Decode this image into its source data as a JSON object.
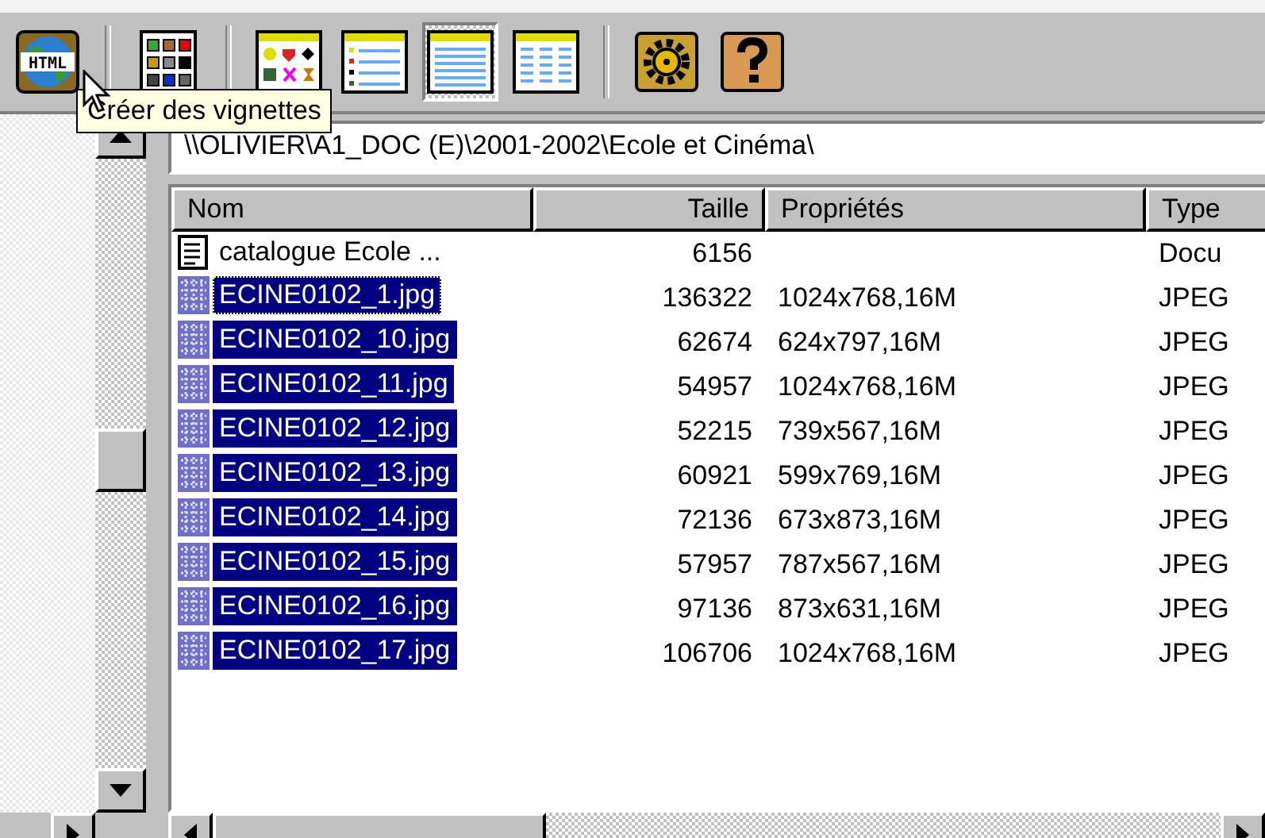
{
  "toolbar": {
    "buttons": [
      {
        "kind": "html",
        "label": "HTML",
        "selected": false
      },
      {
        "kind": "grid",
        "selected": false
      },
      {
        "kind": "thumbnails",
        "selected": false
      },
      {
        "kind": "details",
        "selected": false
      },
      {
        "kind": "list",
        "selected": true
      },
      {
        "kind": "columns",
        "selected": false
      },
      {
        "kind": "settings",
        "selected": false
      },
      {
        "kind": "help",
        "selected": false
      }
    ]
  },
  "tooltip": {
    "text": "Créer des vignettes"
  },
  "path": "\\\\OLIVIER\\A1_DOC (E)\\2001-2002\\Ecole et Cinéma\\",
  "table": {
    "columns": [
      "Nom",
      "Taille",
      "Propriétés",
      "Type"
    ],
    "rows": [
      {
        "kind": "document",
        "name": "catalogue Ecole ...",
        "size": "6156",
        "properties": "",
        "type": "Docu",
        "selected": false,
        "focused": false
      },
      {
        "kind": "image",
        "name": "ECINE0102_1.jpg",
        "size": "136322",
        "properties": "1024x768,16M",
        "type": "JPEG",
        "selected": true,
        "focused": true
      },
      {
        "kind": "image",
        "name": "ECINE0102_10.jpg",
        "size": "62674",
        "properties": "624x797,16M",
        "type": "JPEG",
        "selected": true,
        "focused": false
      },
      {
        "kind": "image",
        "name": "ECINE0102_11.jpg",
        "size": "54957",
        "properties": "1024x768,16M",
        "type": "JPEG",
        "selected": true,
        "focused": false
      },
      {
        "kind": "image",
        "name": "ECINE0102_12.jpg",
        "size": "52215",
        "properties": "739x567,16M",
        "type": "JPEG",
        "selected": true,
        "focused": false
      },
      {
        "kind": "image",
        "name": "ECINE0102_13.jpg",
        "size": "60921",
        "properties": "599x769,16M",
        "type": "JPEG",
        "selected": true,
        "focused": false
      },
      {
        "kind": "image",
        "name": "ECINE0102_14.jpg",
        "size": "72136",
        "properties": "673x873,16M",
        "type": "JPEG",
        "selected": true,
        "focused": false
      },
      {
        "kind": "image",
        "name": "ECINE0102_15.jpg",
        "size": "57957",
        "properties": "787x567,16M",
        "type": "JPEG",
        "selected": true,
        "focused": false
      },
      {
        "kind": "image",
        "name": "ECINE0102_16.jpg",
        "size": "97136",
        "properties": "873x631,16M",
        "type": "JPEG",
        "selected": true,
        "focused": false
      },
      {
        "kind": "image",
        "name": "ECINE0102_17.jpg",
        "size": "106706",
        "properties": "1024x768,16M",
        "type": "JPEG",
        "selected": true,
        "focused": false
      }
    ]
  }
}
